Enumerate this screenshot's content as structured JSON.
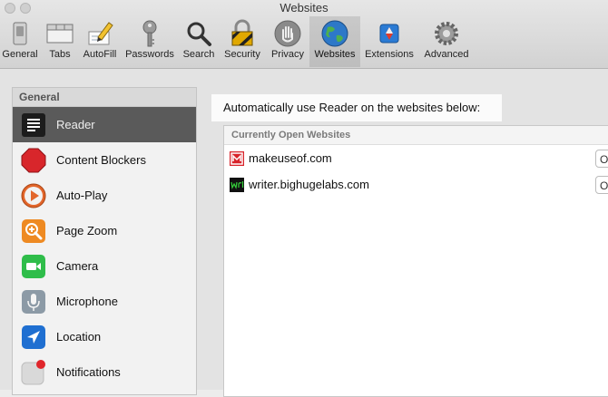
{
  "window": {
    "title": "Websites"
  },
  "toolbar": {
    "items": [
      {
        "label": "General",
        "icon": "general-switch-icon"
      },
      {
        "label": "Tabs",
        "icon": "tabs-icon"
      },
      {
        "label": "AutoFill",
        "icon": "autofill-pencil-icon"
      },
      {
        "label": "Passwords",
        "icon": "key-icon"
      },
      {
        "label": "Search",
        "icon": "magnifier-icon"
      },
      {
        "label": "Security",
        "icon": "padlock-icon"
      },
      {
        "label": "Privacy",
        "icon": "hand-icon"
      },
      {
        "label": "Websites",
        "icon": "globe-icon",
        "selected": true
      },
      {
        "label": "Extensions",
        "icon": "puzzle-icon"
      },
      {
        "label": "Advanced",
        "icon": "gear-icon"
      }
    ]
  },
  "sidebar": {
    "header": "General",
    "items": [
      {
        "label": "Reader",
        "icon": "reader-icon",
        "selected": true
      },
      {
        "label": "Content Blockers",
        "icon": "stop-sign-icon"
      },
      {
        "label": "Auto-Play",
        "icon": "play-icon"
      },
      {
        "label": "Page Zoom",
        "icon": "zoom-icon"
      },
      {
        "label": "Camera",
        "icon": "camera-icon"
      },
      {
        "label": "Microphone",
        "icon": "microphone-icon"
      },
      {
        "label": "Location",
        "icon": "location-arrow-icon"
      },
      {
        "label": "Notifications",
        "icon": "notifications-icon"
      }
    ]
  },
  "main": {
    "heading": "Automatically use Reader on the websites below:",
    "panel_title": "Currently Open Websites",
    "sites": [
      {
        "name": "makeuseof.com",
        "option": "O"
      },
      {
        "name": "writer.bighugelabs.com",
        "option": "O"
      }
    ]
  },
  "colors": {
    "selected_sidebar": "#5a5a5a",
    "toolbar_bg": "#d8d8d8"
  }
}
